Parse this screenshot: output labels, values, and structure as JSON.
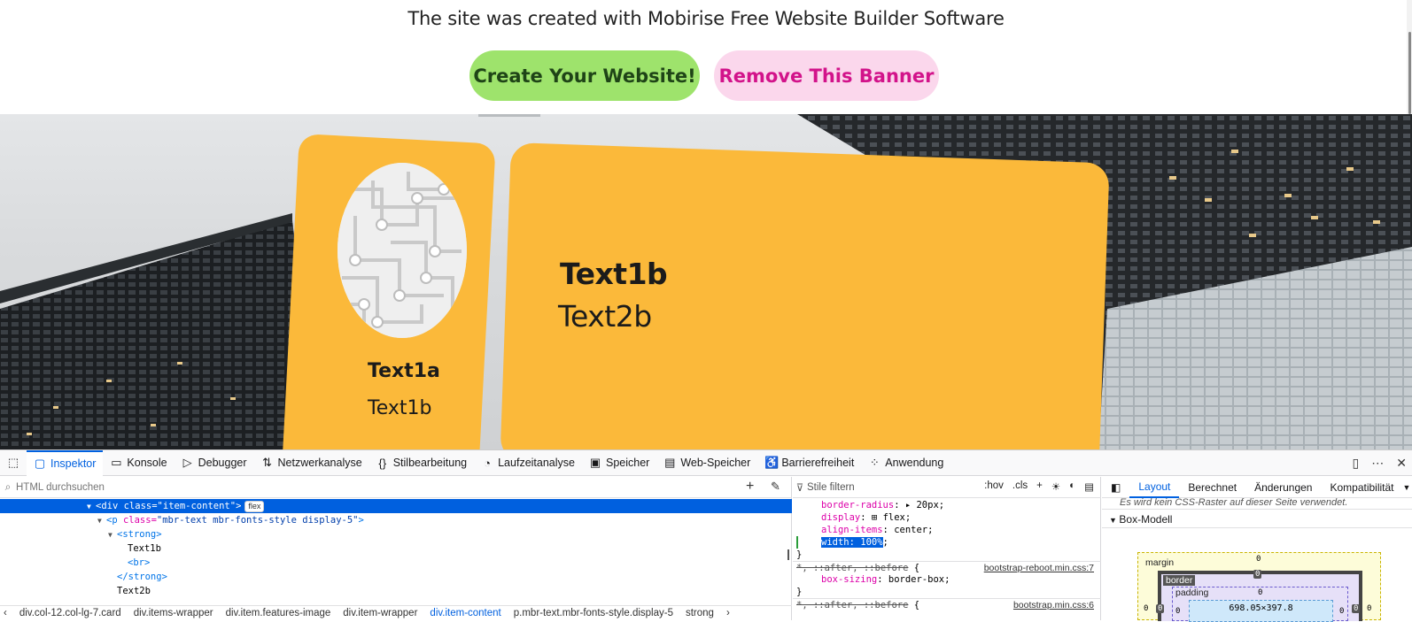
{
  "banner": {
    "text": "The site was created with Mobirise Free Website Builder Software",
    "create_label": "Create Your Website!",
    "remove_label": "Remove This Banner",
    "create_color": "#9ee36c",
    "remove_color": "#fbd7ec"
  },
  "hero": {
    "card_color": "#fbb93a",
    "card_a_title": "Text1a",
    "card_a_subtitle": "Text1b",
    "card_b_title": "Text1b",
    "card_b_subtitle": "Text2b"
  },
  "devtools": {
    "tabs": [
      {
        "label": "Inspektor",
        "icon": "inspector-icon"
      },
      {
        "label": "Konsole",
        "icon": "console-icon"
      },
      {
        "label": "Debugger",
        "icon": "debugger-icon"
      },
      {
        "label": "Netzwerkanalyse",
        "icon": "network-icon"
      },
      {
        "label": "Stilbearbeitung",
        "icon": "style-editor-icon"
      },
      {
        "label": "Laufzeitanalyse",
        "icon": "performance-icon"
      },
      {
        "label": "Speicher",
        "icon": "memory-icon"
      },
      {
        "label": "Web-Speicher",
        "icon": "storage-icon"
      },
      {
        "label": "Barrierefreiheit",
        "icon": "accessibility-icon"
      },
      {
        "label": "Anwendung",
        "icon": "application-icon"
      }
    ],
    "search_placeholder": "HTML durchsuchen",
    "tree": {
      "line1_tag": "<div ",
      "line1_attr": "class=",
      "line1_val": "\"item-content\"",
      "line1_end": ">",
      "line1_badge": "flex",
      "line2_tag": "<p ",
      "line2_attr": "class=",
      "line2_val": "\"mbr-text mbr-fonts-style display-5\"",
      "line2_end": ">",
      "line3": "<strong>",
      "line4": "Text1b",
      "line5": "<br>",
      "line6": "</strong>",
      "line7": "Text2b"
    },
    "breadcrumbs": [
      "div.col-12.col-lg-7.card",
      "div.items-wrapper",
      "div.item.features-image",
      "div.item-wrapper",
      "div.item-content",
      "p.mbr-text.mbr-fonts-style.display-5",
      "strong"
    ],
    "filter_placeholder": "Stile filtern",
    "filter_tools": [
      ":hov",
      ".cls"
    ],
    "rules": {
      "r1_prop": "border-radius",
      "r1_val": "20px",
      "r2_prop": "display",
      "r2_val": "flex",
      "r3_prop": "align-items",
      "r3_val": "center",
      "r4": "width: 100%",
      "r5_sel": "*, ::after, ::before",
      "r5_src": "bootstrap-reboot.min.css:7",
      "r6_prop": "box-sizing",
      "r6_val": "border-box",
      "r7_sel": "*, ::after, ::before",
      "r7_src": "bootstrap.min.css:6"
    },
    "right_tabs": [
      "Layout",
      "Berechnet",
      "Änderungen",
      "Kompatibilität"
    ],
    "grid_note": "Es wird kein CSS-Raster auf dieser Seite verwendet.",
    "box_model_title": "Box-Modell",
    "box": {
      "margin_label": "margin",
      "border_label": "border",
      "padding_label": "padding",
      "content_size": "698.05×397.8",
      "zero": "0"
    }
  }
}
